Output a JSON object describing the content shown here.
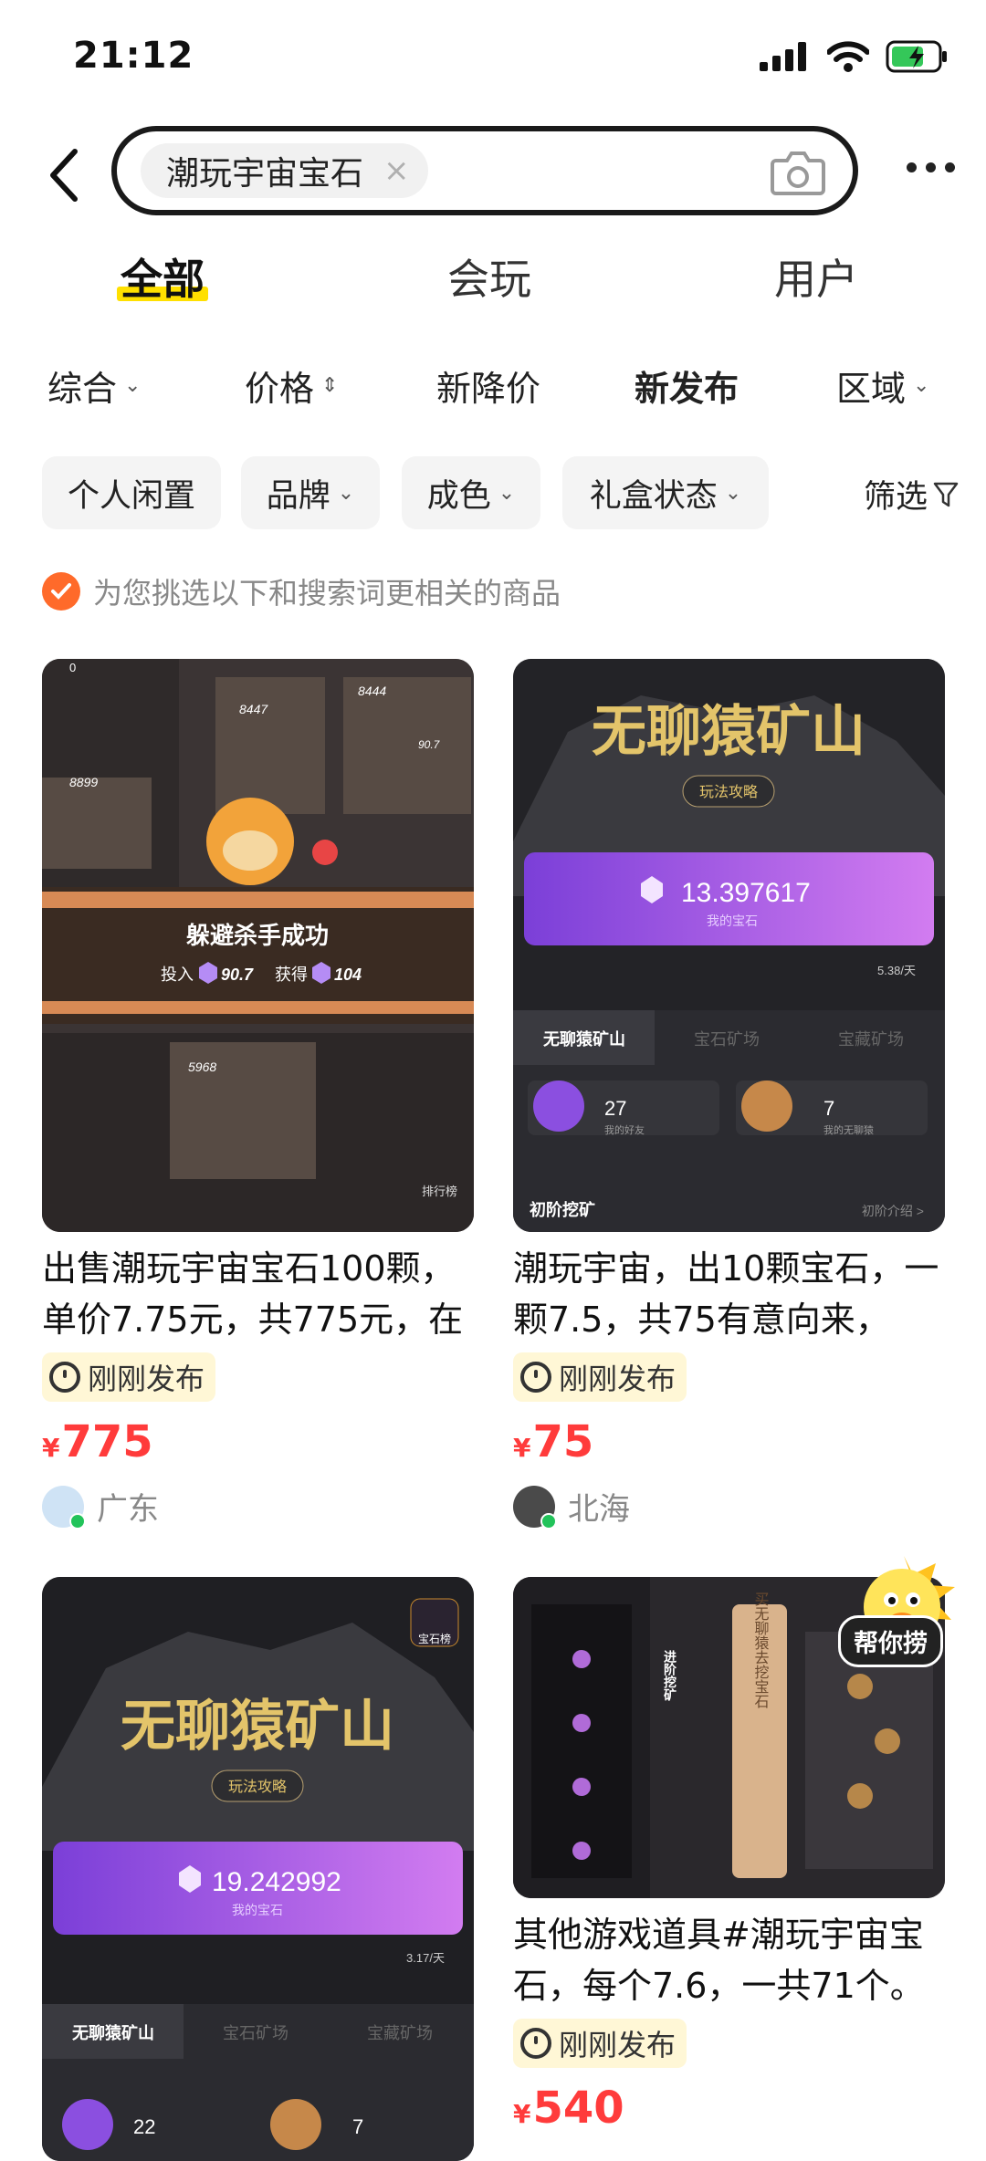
{
  "status": {
    "time": "21:12"
  },
  "search": {
    "query": "潮玩宇宙宝石",
    "clear": "×"
  },
  "tabs": [
    {
      "label": "全部",
      "active": true
    },
    {
      "label": "会玩"
    },
    {
      "label": "用户"
    }
  ],
  "sort": [
    {
      "label": "综合"
    },
    {
      "label": "价格"
    },
    {
      "label": "新降价"
    },
    {
      "label": "新发布",
      "active": true
    },
    {
      "label": "区域"
    }
  ],
  "filters": [
    {
      "label": "个人闲置"
    },
    {
      "label": "品牌"
    },
    {
      "label": "成色"
    },
    {
      "label": "礼盒状态"
    }
  ],
  "filter_button": "筛选",
  "hint": "为您挑选以下和搜索词更相关的商品",
  "currency": "¥",
  "products": [
    {
      "title": "出售潮玩宇宙宝石100颗，单价7.75元，共775元，在",
      "badge": "刚刚发布",
      "price": "775",
      "location": "广东",
      "image": {
        "banner": "躲避杀手成功",
        "invest_label": "投入",
        "invest": "90.7",
        "gain_label": "获得",
        "gain": "104",
        "n1": "0",
        "n2": "8447",
        "n3": "8444",
        "n4": "8899",
        "n5": "90.7",
        "n6": "5968",
        "rank": "排行榜"
      }
    },
    {
      "title": "潮玩宇宙，出10颗宝石，一颗7.5，共75有意向来，",
      "badge": "刚刚发布",
      "price": "75",
      "location": "北海",
      "image": {
        "logo": "无聊猿矿山",
        "guide": "玩法攻略",
        "gems": "13.397617",
        "gems_label": "我的宝石",
        "rate": "5.38/天",
        "tab1": "无聊猿矿山",
        "tab2": "宝石矿场",
        "tab3": "宝藏矿场",
        "friends": "27",
        "friends_label": "我的好友",
        "apes": "7",
        "apes_label": "我的无聊猿",
        "level": "初阶挖矿",
        "level_more": "初阶介绍 >"
      }
    },
    {
      "image": {
        "logo": "无聊猿矿山",
        "guide": "玩法攻略",
        "gems": "19.242992",
        "gems_label": "我的宝石",
        "rate": "3.17/天",
        "tab1": "无聊猿矿山",
        "tab2": "宝石矿场",
        "tab3": "宝藏矿场",
        "friends": "22",
        "apes": "7",
        "corner": "宝石榜"
      }
    },
    {
      "title": "其他游戏道具#潮玩宇宙宝石，每个7.6，一共71个。",
      "badge": "刚刚发布",
      "price": "540",
      "image": {
        "label": "买无聊猿去挖宝石",
        "side": "进阶挖矿"
      }
    }
  ],
  "floating_helper": "帮你捞"
}
